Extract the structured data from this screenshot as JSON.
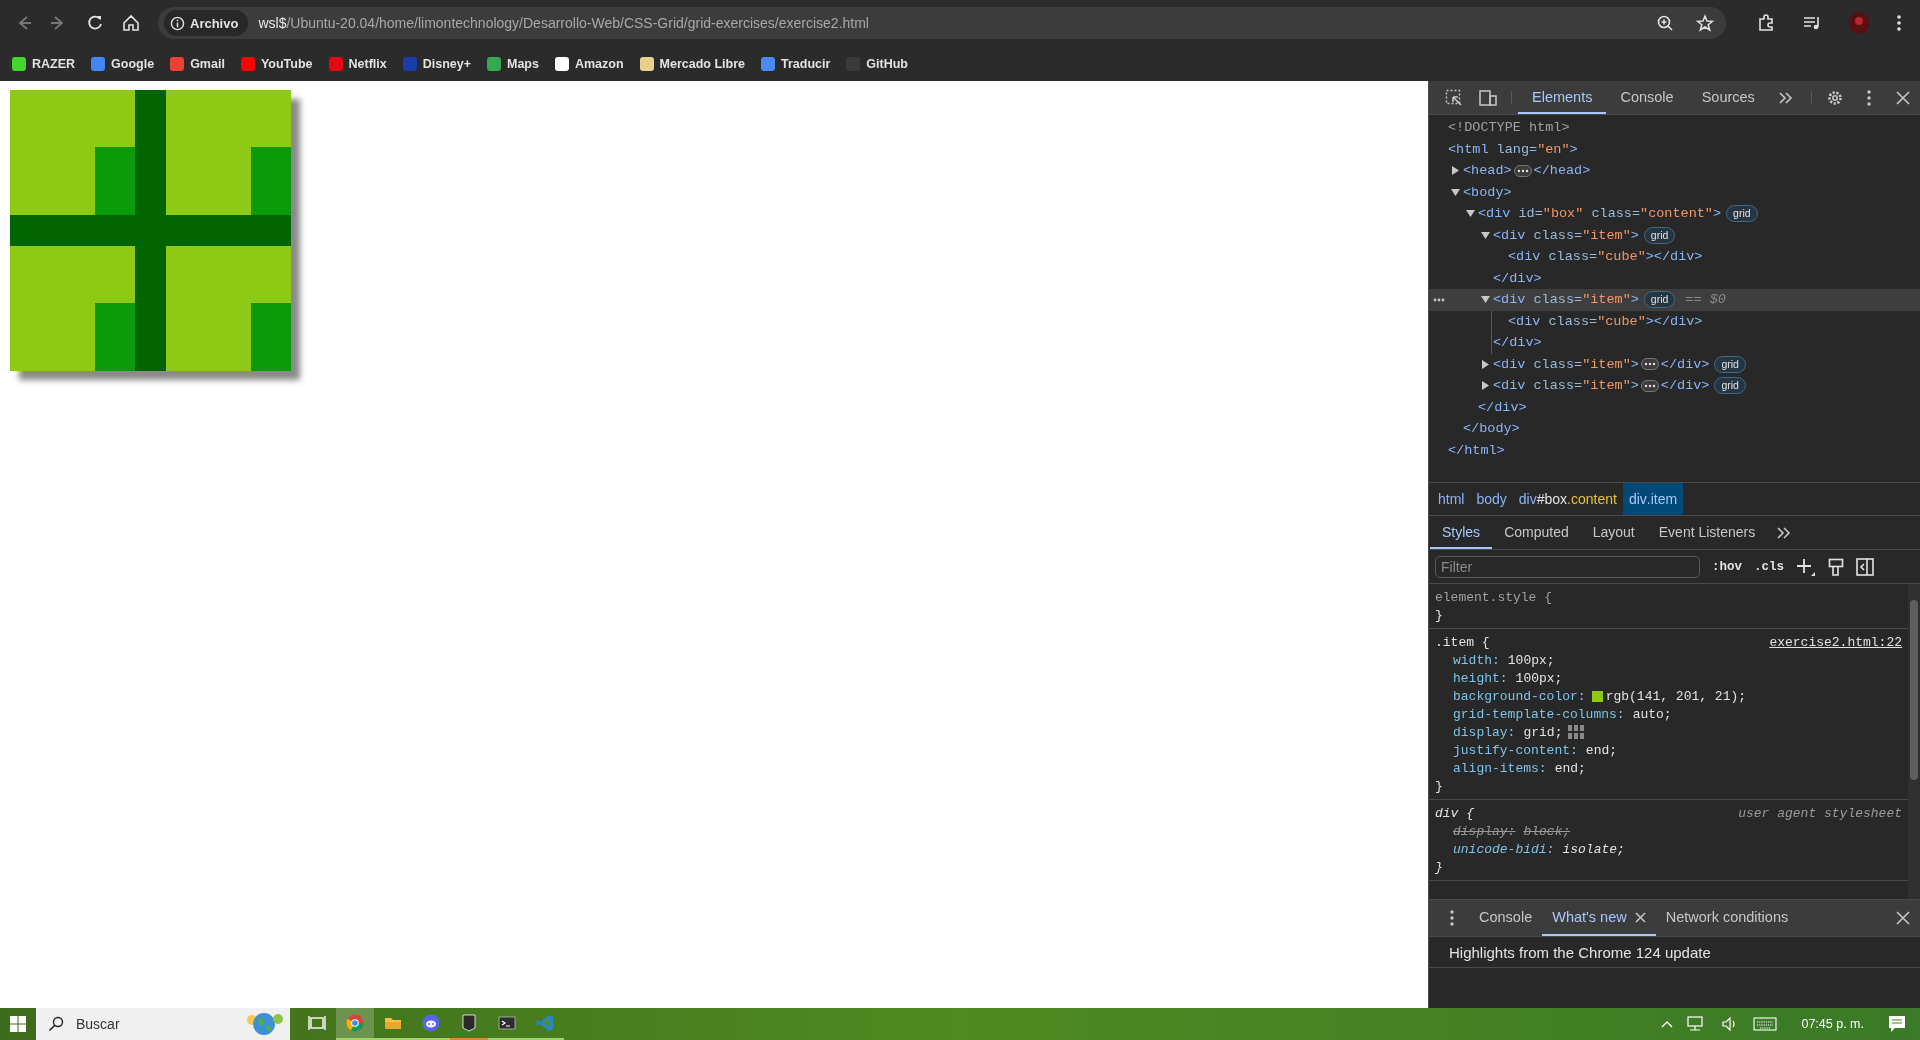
{
  "browser": {
    "nav": [
      {
        "kind": "back",
        "disabled": true
      },
      {
        "kind": "forward",
        "disabled": true
      },
      {
        "kind": "reload",
        "disabled": false
      },
      {
        "kind": "home",
        "disabled": false
      }
    ],
    "omnibox": {
      "chip": "Archivo",
      "host": "wsl$",
      "path": "/Ubuntu-20.04/home/limontechnology/Desarrollo-Web/CSS-Grid/grid-exercises/exercise2.html"
    },
    "bookmarks": [
      {
        "label": "RAZER",
        "color": "#44d62c"
      },
      {
        "label": "Google",
        "color": "#4285f4"
      },
      {
        "label": "Gmail",
        "color": "#ea4335"
      },
      {
        "label": "YouTube",
        "color": "#ff0000"
      },
      {
        "label": "Netflix",
        "color": "#e50914"
      },
      {
        "label": "Disney+",
        "color": "#1a3ca8"
      },
      {
        "label": "Maps",
        "color": "#34a853"
      },
      {
        "label": "Amazon",
        "color": "#ffffff"
      },
      {
        "label": "Mercado Libre",
        "color": "#e8d18a"
      },
      {
        "label": "Traducir",
        "color": "#4a8af4"
      },
      {
        "label": "GitHub",
        "color": "#3a3a3a"
      }
    ]
  },
  "devtools": {
    "main_tabs": [
      {
        "label": "Elements",
        "selected": true
      },
      {
        "label": "Console",
        "selected": false
      },
      {
        "label": "Sources",
        "selected": false
      }
    ],
    "dom_tree": [
      {
        "selected": false,
        "parts": [
          {
            "kind": "code",
            "tokens": [
              {
                "kind": "doctype",
                "text": "<!DOCTYPE html>"
              }
            ]
          }
        ]
      },
      {
        "selected": false,
        "parts": [
          {
            "kind": "code",
            "tokens": [
              {
                "kind": "tag",
                "text": "<html"
              },
              {
                "kind": "attr",
                "text": " lang="
              },
              {
                "kind": "value",
                "text": "\"en\""
              },
              {
                "kind": "tag",
                "text": ">"
              }
            ]
          }
        ],
        "closing": [
          {
            "kind": "tag",
            "text": "</html>"
          }
        ],
        "children": [
          {
            "selected": false,
            "expanded": false,
            "parts": [
              {
                "kind": "code",
                "tokens": [
                  {
                    "kind": "tag",
                    "text": "<head>"
                  }
                ]
              },
              {
                "kind": "ellipsis"
              },
              {
                "kind": "code",
                "tokens": [
                  {
                    "kind": "tag",
                    "text": "</head>"
                  }
                ]
              }
            ]
          },
          {
            "selected": false,
            "expanded": true,
            "parts": [
              {
                "kind": "code",
                "tokens": [
                  {
                    "kind": "tag",
                    "text": "<body>"
                  }
                ]
              }
            ],
            "closing": [
              {
                "kind": "tag",
                "text": "</body>"
              }
            ],
            "children": [
              {
                "selected": false,
                "expanded": true,
                "parts": [
                  {
                    "kind": "code",
                    "tokens": [
                      {
                        "kind": "tag",
                        "text": "<div"
                      },
                      {
                        "kind": "attr",
                        "text": " id="
                      },
                      {
                        "kind": "value",
                        "text": "\"box\""
                      },
                      {
                        "kind": "attr",
                        "text": " class="
                      },
                      {
                        "kind": "value",
                        "text": "\"content\""
                      },
                      {
                        "kind": "tag",
                        "text": ">"
                      }
                    ]
                  },
                  {
                    "kind": "badge",
                    "text": "grid"
                  }
                ],
                "closing": [
                  {
                    "kind": "tag",
                    "text": "</div>"
                  }
                ],
                "children": [
                  {
                    "selected": false,
                    "expanded": true,
                    "parts": [
                      {
                        "kind": "code",
                        "tokens": [
                          {
                            "kind": "tag",
                            "text": "<div"
                          },
                          {
                            "kind": "attr",
                            "text": " class="
                          },
                          {
                            "kind": "value",
                            "text": "\"item\""
                          },
                          {
                            "kind": "tag",
                            "text": ">"
                          }
                        ]
                      },
                      {
                        "kind": "badge",
                        "text": "grid"
                      }
                    ],
                    "closing": [
                      {
                        "kind": "tag",
                        "text": "</div>"
                      }
                    ],
                    "children": [
                      {
                        "selected": false,
                        "parts": [
                          {
                            "kind": "code",
                            "tokens": [
                              {
                                "kind": "tag",
                                "text": "<div"
                              },
                              {
                                "kind": "attr",
                                "text": " class="
                              },
                              {
                                "kind": "value",
                                "text": "\"cube\""
                              },
                              {
                                "kind": "tag",
                                "text": "></div>"
                              }
                            ]
                          }
                        ]
                      }
                    ]
                  },
                  {
                    "selected": true,
                    "expanded": true,
                    "parts": [
                      {
                        "kind": "code",
                        "tokens": [
                          {
                            "kind": "tag",
                            "text": "<div"
                          },
                          {
                            "kind": "attr",
                            "text": " class="
                          },
                          {
                            "kind": "value",
                            "text": "\"item\""
                          },
                          {
                            "kind": "tag",
                            "text": ">"
                          }
                        ]
                      },
                      {
                        "kind": "badge",
                        "text": "grid"
                      },
                      {
                        "kind": "ref",
                        "text": "== $0"
                      }
                    ],
                    "closing": [
                      {
                        "kind": "tag",
                        "text": "</div>"
                      }
                    ],
                    "children": [
                      {
                        "selected": false,
                        "parts": [
                          {
                            "kind": "code",
                            "tokens": [
                              {
                                "kind": "tag",
                                "text": "<div"
                              },
                              {
                                "kind": "attr",
                                "text": " class="
                              },
                              {
                                "kind": "value",
                                "text": "\"cube\""
                              },
                              {
                                "kind": "tag",
                                "text": "></div>"
                              }
                            ]
                          }
                        ]
                      }
                    ]
                  },
                  {
                    "selected": false,
                    "expanded": false,
                    "parts": [
                      {
                        "kind": "code",
                        "tokens": [
                          {
                            "kind": "tag",
                            "text": "<div"
                          },
                          {
                            "kind": "attr",
                            "text": " class="
                          },
                          {
                            "kind": "value",
                            "text": "\"item\""
                          },
                          {
                            "kind": "tag",
                            "text": ">"
                          }
                        ]
                      },
                      {
                        "kind": "ellipsis"
                      },
                      {
                        "kind": "code",
                        "tokens": [
                          {
                            "kind": "tag",
                            "text": "</div>"
                          }
                        ]
                      },
                      {
                        "kind": "badge",
                        "text": "grid"
                      }
                    ]
                  },
                  {
                    "selected": false,
                    "expanded": false,
                    "parts": [
                      {
                        "kind": "code",
                        "tokens": [
                          {
                            "kind": "tag",
                            "text": "<div"
                          },
                          {
                            "kind": "attr",
                            "text": " class="
                          },
                          {
                            "kind": "value",
                            "text": "\"item\""
                          },
                          {
                            "kind": "tag",
                            "text": ">"
                          }
                        ]
                      },
                      {
                        "kind": "ellipsis"
                      },
                      {
                        "kind": "code",
                        "tokens": [
                          {
                            "kind": "tag",
                            "text": "</div>"
                          }
                        ]
                      },
                      {
                        "kind": "badge",
                        "text": "grid"
                      }
                    ]
                  }
                ]
              }
            ]
          }
        ]
      }
    ],
    "breadcrumbs": [
      {
        "tag": "html",
        "selected": false
      },
      {
        "tag": "body",
        "selected": false
      },
      {
        "tag": "div",
        "id": "#box",
        "classes": ".content",
        "selected": false
      },
      {
        "tag": "div",
        "classes": ".item",
        "selected": true
      }
    ],
    "style_tabs": [
      {
        "label": "Styles",
        "selected": true
      },
      {
        "label": "Computed",
        "selected": false
      },
      {
        "label": "Layout",
        "selected": false
      },
      {
        "label": "Event Listeners",
        "selected": false
      }
    ],
    "filter": {
      "placeholder": "Filter"
    },
    "style_buttons": [
      ":hov",
      ".cls"
    ],
    "rules": [
      {
        "kind": "inline",
        "selector": "element.style",
        "open": "{",
        "close": "}"
      },
      {
        "kind": "author",
        "selector": ".item",
        "open": "{",
        "close": "}",
        "source": "exercise2.html:22",
        "declarations": [
          {
            "kind": "plain",
            "name": "width:",
            "value": "100px;",
            "overridden": false
          },
          {
            "kind": "plain",
            "name": "height:",
            "value": "100px;",
            "overridden": false
          },
          {
            "kind": "color",
            "name": "background-color:",
            "value": "rgb(141, 201, 21);",
            "overridden": false,
            "color": "#8dc915"
          },
          {
            "kind": "plain",
            "name": "grid-template-columns:",
            "value": "auto;",
            "overridden": false
          },
          {
            "kind": "grid",
            "name": "display:",
            "value": "grid;",
            "overridden": false
          },
          {
            "kind": "plain",
            "name": "justify-content:",
            "value": "end;",
            "overridden": false
          },
          {
            "kind": "plain",
            "name": "align-items:",
            "value": "end;",
            "overridden": false
          }
        ]
      },
      {
        "kind": "user-agent",
        "selector": "div",
        "open": "{",
        "close": "}",
        "source": "user agent stylesheet",
        "declarations": [
          {
            "kind": "plain",
            "name": "display:",
            "value": "block;",
            "overridden": true
          },
          {
            "kind": "plain",
            "name": "unicode-bidi:",
            "value": "isolate;",
            "overridden": false
          }
        ]
      }
    ],
    "drawer": {
      "tabs": [
        {
          "label": "Console",
          "selected": false,
          "closable": false
        },
        {
          "label": "What's new",
          "selected": true,
          "closable": true
        },
        {
          "label": "Network conditions",
          "selected": false,
          "closable": false
        }
      ],
      "headline": "Highlights from the Chrome 124 update"
    }
  },
  "taskbar": {
    "search_placeholder": "Buscar",
    "apps": [
      {
        "kind": "taskview",
        "focused": false
      },
      {
        "kind": "chrome",
        "focused": true
      },
      {
        "kind": "files",
        "focused": false
      },
      {
        "kind": "discord",
        "focused": false
      },
      {
        "kind": "epic",
        "focused": false
      },
      {
        "kind": "terminal",
        "focused": false
      },
      {
        "kind": "vscode",
        "focused": false
      }
    ],
    "clock": "07:45 p. m."
  }
}
